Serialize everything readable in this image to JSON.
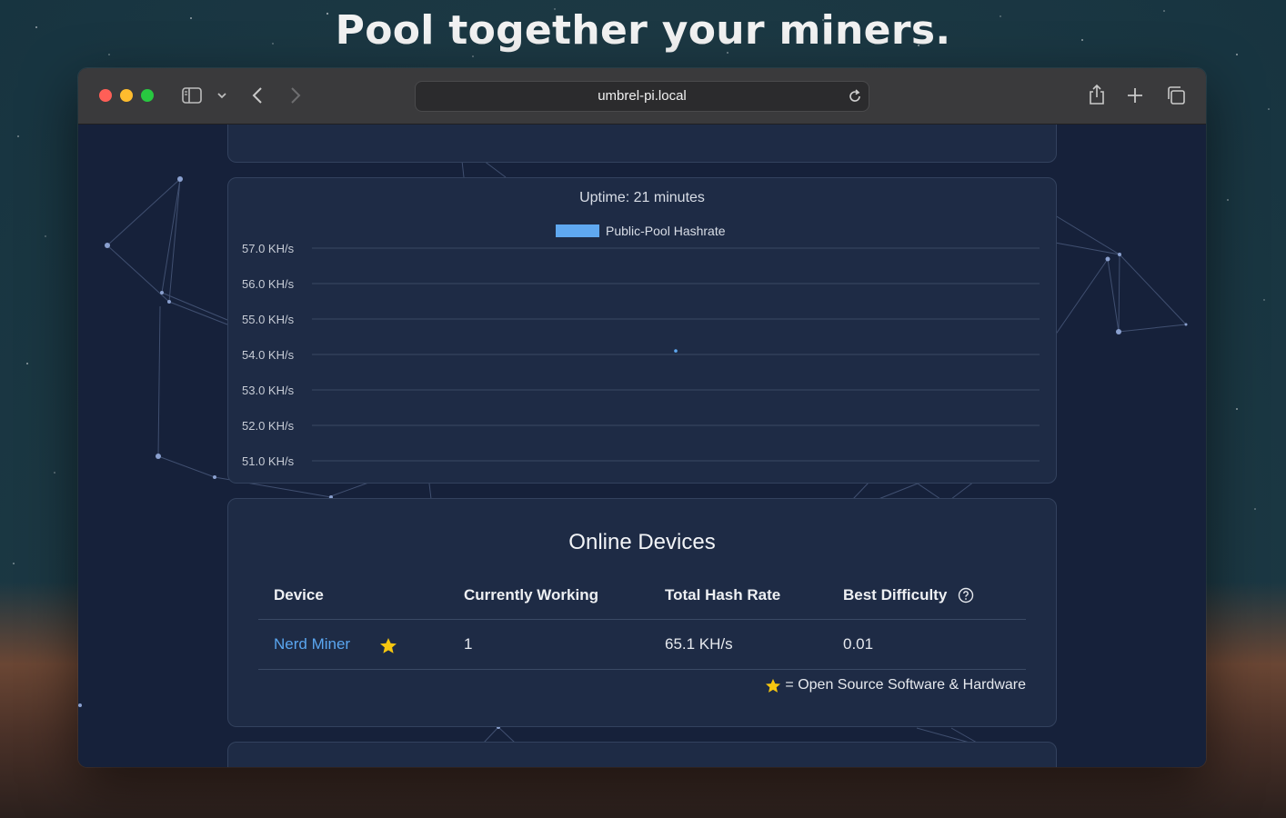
{
  "headline": "Pool together your miners.",
  "browser": {
    "url": "umbrel-pi.local"
  },
  "chart_card": {
    "title": "Uptime: 21 minutes",
    "legend": "Public-Pool Hashrate",
    "accent": "#5fa8f0"
  },
  "chart_data": {
    "type": "line",
    "title": "Uptime: 21 minutes",
    "series": [
      {
        "name": "Public-Pool Hashrate",
        "points": [
          {
            "x": 0.5,
            "y": 54.1
          }
        ]
      }
    ],
    "yticks": [
      "57.0 KH/s",
      "56.0 KH/s",
      "55.0 KH/s",
      "54.0 KH/s",
      "53.0 KH/s",
      "52.0 KH/s",
      "51.0 KH/s"
    ],
    "ylim": [
      51.0,
      57.0
    ],
    "xlim": [
      0,
      1
    ],
    "grid": true,
    "legend_position": "top-center"
  },
  "devices": {
    "title": "Online Devices",
    "columns": [
      "Device",
      "Currently Working",
      "Total Hash Rate",
      "Best Difficulty"
    ],
    "rows": [
      {
        "device": "Nerd Miner",
        "working": "1",
        "hashrate": "65.1 KH/s",
        "difficulty": "0.01"
      }
    ],
    "footnote": "= Open Source Software & Hardware"
  },
  "icons": {
    "traffic_lights": [
      "#ff5f57",
      "#febc2e",
      "#28c840"
    ],
    "star_color": "#f6c610",
    "help_icon": "question-circle-icon"
  }
}
